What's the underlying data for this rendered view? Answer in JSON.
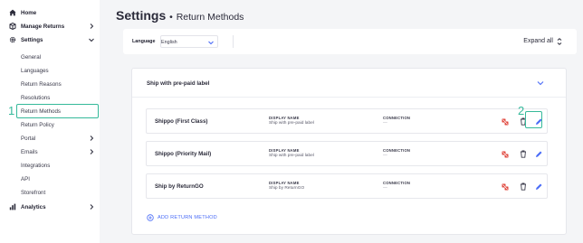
{
  "sidebar": {
    "items": [
      {
        "label": "Home",
        "icon": "home-icon",
        "level": "top",
        "chevron": false
      },
      {
        "label": "Manage Returns",
        "icon": "returns-icon",
        "level": "top",
        "chevron": "right"
      },
      {
        "label": "Settings",
        "icon": "gear-icon",
        "level": "top",
        "chevron": "down"
      },
      {
        "label": "General",
        "level": "sub"
      },
      {
        "label": "Languages",
        "level": "sub"
      },
      {
        "label": "Return Reasons",
        "level": "sub"
      },
      {
        "label": "Resolutions",
        "level": "sub"
      },
      {
        "label": "Return Methods",
        "level": "sub",
        "active": true
      },
      {
        "label": "Return Policy",
        "level": "sub"
      },
      {
        "label": "Portal",
        "level": "sub",
        "chevron": "right"
      },
      {
        "label": "Emails",
        "level": "sub",
        "chevron": "right"
      },
      {
        "label": "Integrations",
        "level": "sub"
      },
      {
        "label": "API",
        "level": "sub"
      },
      {
        "label": "Storefront",
        "level": "sub"
      },
      {
        "label": "Analytics",
        "icon": "chart-icon",
        "level": "top",
        "chevron": "right"
      }
    ]
  },
  "annotations": {
    "marker1": "1",
    "marker2": "2"
  },
  "header": {
    "title": "Settings",
    "separator": "•",
    "subtitle": "Return Methods"
  },
  "language_bar": {
    "label": "Language",
    "selected": "English",
    "expand_all": "Expand all"
  },
  "panel": {
    "title": "Ship with pre-paid label",
    "methods": [
      {
        "name": "Shippo (First Class)",
        "display_label": "DISPLAY NAME",
        "display_value": "Ship with pre-paid label",
        "connection_label": "CONNECTION",
        "connection_value": "—"
      },
      {
        "name": "Shippo (Priority Mail)",
        "display_label": "DISPLAY NAME",
        "display_value": "Ship with pre-paid label",
        "connection_label": "CONNECTION",
        "connection_value": "—"
      },
      {
        "name": "Ship by ReturnGO",
        "display_label": "DISPLAY NAME",
        "display_value": "Ship by ReturnGO",
        "connection_label": "CONNECTION",
        "connection_value": "—"
      }
    ],
    "add_label": "ADD RETURN METHOD"
  },
  "colors": {
    "accent_green": "#35b99a",
    "link_blue": "#4a6cf7",
    "connection_red": "#e0453b"
  }
}
